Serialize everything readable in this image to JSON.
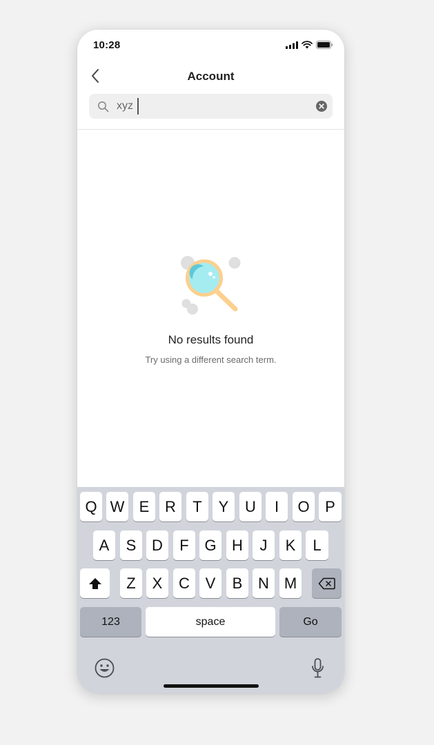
{
  "status_bar": {
    "time": "10:28"
  },
  "header": {
    "title": "Account"
  },
  "search": {
    "value": "xyz"
  },
  "empty_state": {
    "title": "No results found",
    "subtitle": "Try using a different search term."
  },
  "keyboard": {
    "row1": [
      "Q",
      "W",
      "E",
      "R",
      "T",
      "Y",
      "U",
      "I",
      "O",
      "P"
    ],
    "row2": [
      "A",
      "S",
      "D",
      "F",
      "G",
      "H",
      "J",
      "K",
      "L"
    ],
    "row3": [
      "Z",
      "X",
      "C",
      "V",
      "B",
      "N",
      "M"
    ],
    "numbers_label": "123",
    "space_label": "space",
    "go_label": "Go"
  },
  "colors": {
    "illustration_ring": "#fcd08e",
    "illustration_lens": "#a5ecf1",
    "keyboard_bg": "#d1d4db"
  }
}
